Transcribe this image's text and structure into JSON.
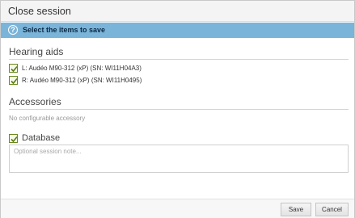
{
  "dialog": {
    "title": "Close session"
  },
  "info": {
    "icon": "question-icon",
    "icon_glyph": "?",
    "text": "Select the items to save",
    "bg_color": "#7bb4d9"
  },
  "hearing_aids": {
    "title": "Hearing aids",
    "items": [
      {
        "label": "L: Audéo M90-312 (xP) (SN: WI11H04A3)",
        "checked": true
      },
      {
        "label": "R: Audéo M90-312 (xP) (SN: WI11H0495)",
        "checked": true
      }
    ]
  },
  "accessories": {
    "title": "Accessories",
    "empty_text": "No configurable accessory"
  },
  "database": {
    "label": "Database",
    "checked": true,
    "note_placeholder": "Optional session note...",
    "note_value": ""
  },
  "footer": {
    "save_label": "Save",
    "cancel_label": "Cancel"
  },
  "colors": {
    "accent": "#7bb4d9",
    "check": "#6a8a1e",
    "section_rule": "#cfe0a8"
  }
}
